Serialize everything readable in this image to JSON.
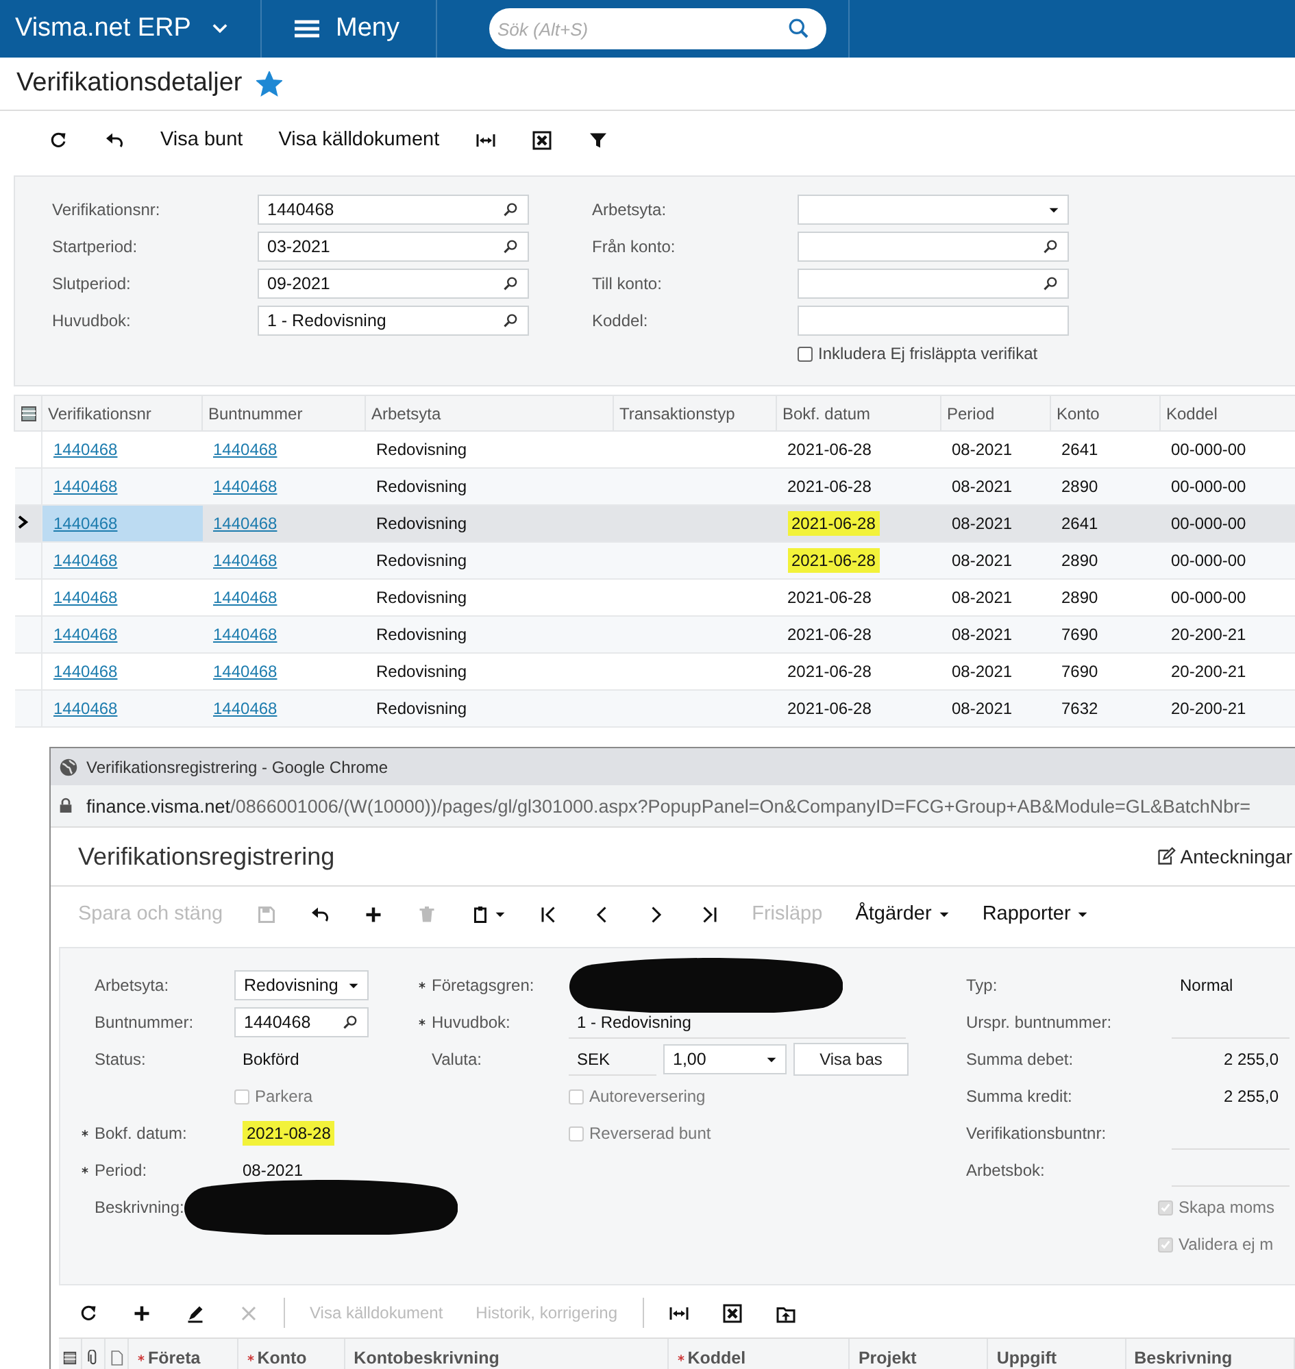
{
  "topbar": {
    "brand": "Visma.net ERP",
    "menu": "Meny",
    "search": {
      "placeholder": "Sök (Alt+S)"
    }
  },
  "page": {
    "title": "Verifikationsdetaljer",
    "favorite": true
  },
  "toolbar": [
    {
      "kind": "refresh"
    },
    {
      "kind": "undo"
    },
    {
      "kind": "text",
      "label": "Visa bunt"
    },
    {
      "kind": "text",
      "label": "Visa källdokument"
    },
    {
      "kind": "fit"
    },
    {
      "kind": "excel"
    },
    {
      "kind": "filter"
    }
  ],
  "filters": {
    "left": [
      {
        "label": "Verifikationsnr:",
        "value": "1440468",
        "kind": "lookup"
      },
      {
        "label": "Startperiod:",
        "value": "03-2021",
        "kind": "lookup"
      },
      {
        "label": "Slutperiod:",
        "value": "09-2021",
        "kind": "lookup"
      },
      {
        "label": "Huvudbok:",
        "value": "1 - Redovisning",
        "kind": "lookup"
      }
    ],
    "right": [
      {
        "label": "Arbetsyta:",
        "kind": "select"
      },
      {
        "label": "Från konto:",
        "kind": "lookup"
      },
      {
        "label": "Till konto:",
        "kind": "lookup"
      },
      {
        "label": "Koddel:",
        "kind": "text"
      }
    ],
    "checkbox": {
      "label": "Inkludera Ej frisläppta verifikat",
      "checked": false
    }
  },
  "grid": {
    "columns": [
      "Verifikationsnr",
      "Buntnummer",
      "Arbetsyta",
      "Transaktionstyp",
      "Bokf. datum",
      "Period",
      "Konto",
      "Koddel"
    ],
    "rows": [
      {
        "verifikationsnr": "1440468",
        "buntnummer": "1440468",
        "arbetsyta": "Redovisning",
        "bokf_datum": "2021-06-28",
        "period": "08-2021",
        "konto": "2641",
        "koddel": "00-000-00",
        "selected": false,
        "highlighted": false
      },
      {
        "verifikationsnr": "1440468",
        "buntnummer": "1440468",
        "arbetsyta": "Redovisning",
        "bokf_datum": "2021-06-28",
        "period": "08-2021",
        "konto": "2890",
        "koddel": "00-000-00",
        "selected": false,
        "highlighted": false
      },
      {
        "verifikationsnr": "1440468",
        "buntnummer": "1440468",
        "arbetsyta": "Redovisning",
        "bokf_datum": "2021-06-28",
        "period": "08-2021",
        "konto": "2641",
        "koddel": "00-000-00",
        "selected": true,
        "highlighted": true
      },
      {
        "verifikationsnr": "1440468",
        "buntnummer": "1440468",
        "arbetsyta": "Redovisning",
        "bokf_datum": "2021-06-28",
        "period": "08-2021",
        "konto": "2890",
        "koddel": "00-000-00",
        "selected": false,
        "highlighted": true
      },
      {
        "verifikationsnr": "1440468",
        "buntnummer": "1440468",
        "arbetsyta": "Redovisning",
        "bokf_datum": "2021-06-28",
        "period": "08-2021",
        "konto": "2890",
        "koddel": "00-000-00",
        "selected": false,
        "highlighted": false
      },
      {
        "verifikationsnr": "1440468",
        "buntnummer": "1440468",
        "arbetsyta": "Redovisning",
        "bokf_datum": "2021-06-28",
        "period": "08-2021",
        "konto": "7690",
        "koddel": "20-200-21",
        "selected": false,
        "highlighted": false
      },
      {
        "verifikationsnr": "1440468",
        "buntnummer": "1440468",
        "arbetsyta": "Redovisning",
        "bokf_datum": "2021-06-28",
        "period": "08-2021",
        "konto": "7690",
        "koddel": "20-200-21",
        "selected": false,
        "highlighted": false
      },
      {
        "verifikationsnr": "1440468",
        "buntnummer": "1440468",
        "arbetsyta": "Redovisning",
        "bokf_datum": "2021-06-28",
        "period": "08-2021",
        "konto": "7632",
        "koddel": "20-200-21",
        "selected": false,
        "highlighted": false
      }
    ]
  },
  "popup": {
    "window_title": "Verifikationsregistrering - Google Chrome",
    "url_host": "finance.visma.net",
    "url_path": "/0866001006/(W(10000))/pages/gl/gl301000.aspx?PopupPanel=On&CompanyID=FCG+Group+AB&Module=GL&BatchNbr=",
    "title": "Verifikationsregistrering",
    "notes": "Anteckningar",
    "toolbar": [
      {
        "kind": "text",
        "label": "Spara och stäng",
        "disabled": true
      },
      {
        "kind": "save",
        "disabled": true
      },
      {
        "kind": "undo",
        "disabled": false
      },
      {
        "kind": "plus",
        "disabled": false
      },
      {
        "kind": "trash",
        "disabled": true
      },
      {
        "kind": "clipboard",
        "disabled": false
      },
      {
        "kind": "first",
        "disabled": false
      },
      {
        "kind": "prev",
        "disabled": false
      },
      {
        "kind": "next",
        "disabled": false
      },
      {
        "kind": "last",
        "disabled": false
      },
      {
        "kind": "text",
        "label": "Frisläpp",
        "disabled": true
      },
      {
        "kind": "menu",
        "label": "Åtgärder",
        "disabled": false
      },
      {
        "kind": "menu",
        "label": "Rapporter",
        "disabled": false
      }
    ],
    "form": {
      "left": [
        {
          "kind": "select",
          "label": "Arbetsyta:",
          "value": "Redovisning",
          "required": false
        },
        {
          "kind": "lookup",
          "label": "Buntnummer:",
          "value": "1440468",
          "required": false
        },
        {
          "kind": "text",
          "label": "Status:",
          "value": "Bokförd",
          "required": false
        },
        {
          "kind": "checkbox",
          "label": "Parkera",
          "checked": false,
          "disabled": true
        },
        {
          "kind": "text",
          "label": "Bokf. datum:",
          "value": "2021-08-28",
          "required": true,
          "highlighted": true
        },
        {
          "kind": "text",
          "label": "Period:",
          "value": "08-2021",
          "required": true
        },
        {
          "kind": "redacted",
          "label": "Beskrivning:",
          "required": false
        }
      ],
      "middle": [
        {
          "kind": "redacted",
          "label": "Företagsgren:",
          "required": true
        },
        {
          "kind": "text",
          "label": "Huvudbok:",
          "value": "1 - Redovisning",
          "required": true
        },
        {
          "kind": "currency",
          "label": "Valuta:",
          "value": "SEK",
          "rate": "1,00",
          "button": "Visa bas",
          "required": false
        },
        {
          "kind": "checkbox",
          "label": "Autoreversering",
          "checked": false,
          "disabled": true
        },
        {
          "kind": "checkbox",
          "label": "Reverserad bunt",
          "checked": false,
          "disabled": true
        }
      ],
      "right": [
        {
          "kind": "text",
          "label": "Typ:",
          "value": "Normal"
        },
        {
          "kind": "text",
          "label": "Urspr. buntnummer:"
        },
        {
          "kind": "amount",
          "label": "Summa debet:",
          "value": "2 255,0"
        },
        {
          "kind": "amount",
          "label": "Summa kredit:",
          "value": "2 255,0"
        },
        {
          "kind": "text",
          "label": "Verifikationsbuntnr:"
        },
        {
          "kind": "text",
          "label": "Arbetsbok:"
        },
        {
          "kind": "checkbox",
          "label": "Skapa moms",
          "checked": true,
          "disabled": true
        },
        {
          "kind": "checkbox",
          "label": "Validera ej m",
          "checked": true,
          "disabled": true
        }
      ]
    },
    "grid_toolbar": [
      {
        "kind": "refresh",
        "disabled": false
      },
      {
        "kind": "plus",
        "disabled": false
      },
      {
        "kind": "pencil",
        "disabled": false
      },
      {
        "kind": "x",
        "disabled": true
      },
      {
        "kind": "separator"
      },
      {
        "kind": "text",
        "label": "Visa källdokument",
        "disabled": true
      },
      {
        "kind": "text",
        "label": "Historik, korrigering",
        "disabled": true
      },
      {
        "kind": "separator"
      },
      {
        "kind": "fit",
        "disabled": false
      },
      {
        "kind": "excel",
        "disabled": false
      },
      {
        "kind": "upload",
        "disabled": false
      }
    ],
    "grid_columns": [
      {
        "label": "Företa",
        "required": true
      },
      {
        "label": "Konto",
        "required": true
      },
      {
        "label": "Kontobeskrivning",
        "required": false
      },
      {
        "label": "Koddel",
        "required": true
      },
      {
        "label": "Projekt",
        "required": false
      },
      {
        "label": "Uppgift",
        "required": false
      },
      {
        "label": "Beskrivning",
        "required": false
      }
    ]
  }
}
